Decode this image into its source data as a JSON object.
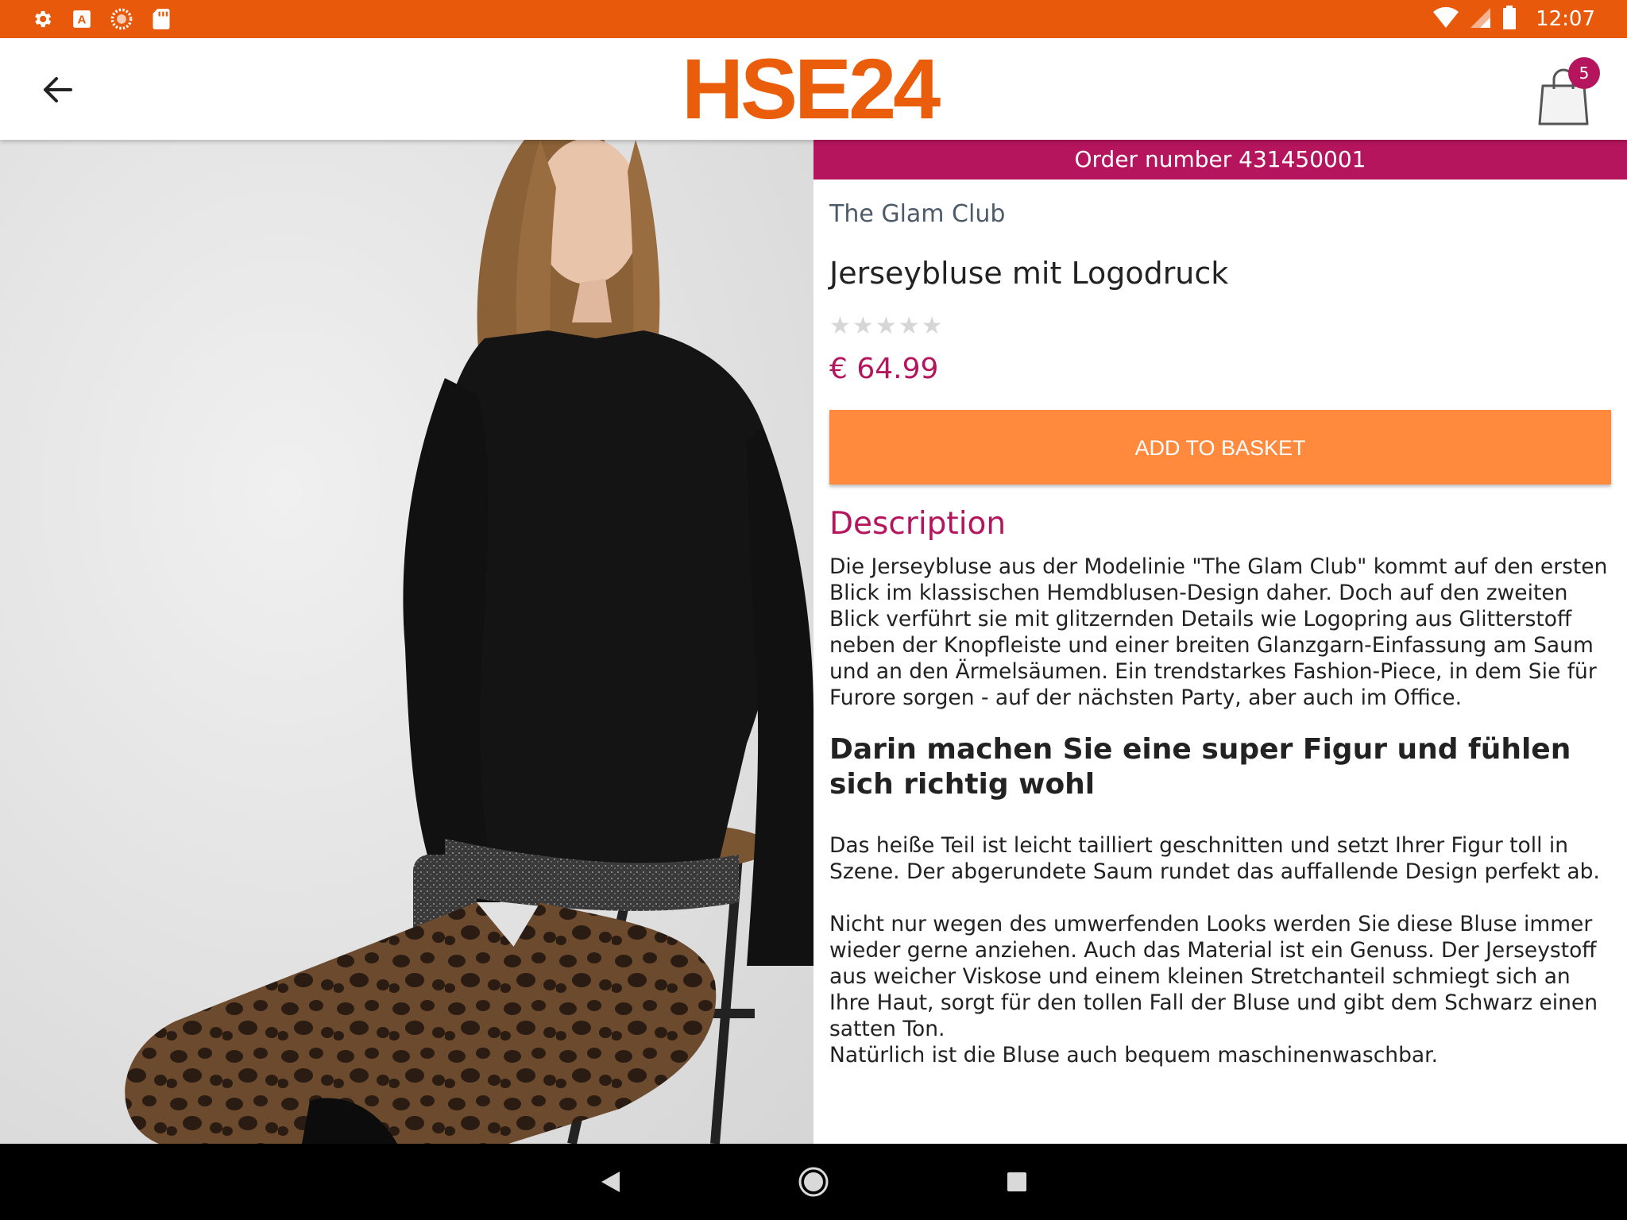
{
  "status_bar": {
    "time": "12:07",
    "left_icons": [
      "gear-icon",
      "font-app-icon",
      "loader-icon",
      "sd-card-icon"
    ],
    "right_icons": [
      "wifi-icon",
      "signal-icon",
      "battery-icon"
    ],
    "color": "#E8590C"
  },
  "app_bar": {
    "logo_text": "HSE24",
    "cart_count": "5"
  },
  "product": {
    "order_label": "Order number  431450001",
    "brand": "The Glam Club",
    "title": "Jerseybluse mit Logodruck",
    "rating": 0,
    "rating_max": 5,
    "price": "€ 64.99",
    "add_to_basket": "ADD TO BASKET",
    "image_pages": 5,
    "active_page": 1
  },
  "description": {
    "heading": "Description",
    "paragraph1": "Die Jerseybluse aus der Modelinie \"The Glam Club\" kommt auf den ersten Blick im klassischen Hemdblusen-Design daher. Doch auf den zweiten Blick verführt sie mit glitzernden Details wie Logopring aus Glitterstoff neben der Knopfleiste und einer breiten Glanzgarn-Einfassung am Saum und an den Ärmelsäumen. Ein trendstarkes Fashion-Piece, in dem Sie für Furore sorgen - auf der nächsten Party, aber auch im Office.",
    "subheading": "Darin machen Sie eine super Figur und fühlen sich richtig wohl",
    "paragraph2": "Das heiße Teil ist leicht tailliert geschnitten und setzt Ihrer Figur toll in Szene. Der abgerundete Saum rundet das auffallende Design perfekt ab.",
    "paragraph3": "Nicht nur wegen des umwerfenden Looks werden Sie diese Bluse immer wieder gerne anziehen. Auch das Material ist ein Genuss. Der Jerseystoff aus weicher Viskose und einem kleinen Stretchanteil schmiegt sich an Ihre Haut, sorgt für den tollen Fall der Bluse und gibt dem Schwarz einen satten Ton.",
    "paragraph4": "Natürlich ist die Bluse auch bequem maschinenwaschbar."
  },
  "colors": {
    "accent_orange": "#EA5D0B",
    "button_orange": "#FF8A3D",
    "magenta": "#B5155C"
  }
}
